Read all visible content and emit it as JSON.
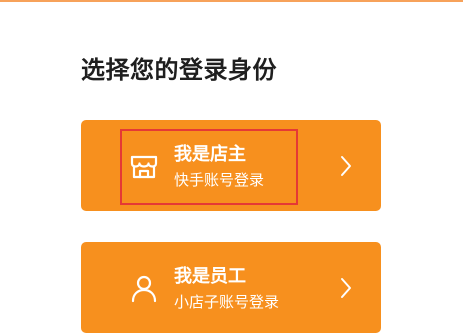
{
  "page": {
    "title": "选择您的登录身份"
  },
  "roles": [
    {
      "title": "我是店主",
      "subtitle": "快手账号登录",
      "icon": "store-icon"
    },
    {
      "title": "我是员工",
      "subtitle": "小店子账号登录",
      "icon": "person-icon"
    }
  ],
  "colors": {
    "accent": "#f7901e",
    "highlight": "#e53935",
    "title_text": "#1f1f1f",
    "card_text": "#ffffff"
  }
}
